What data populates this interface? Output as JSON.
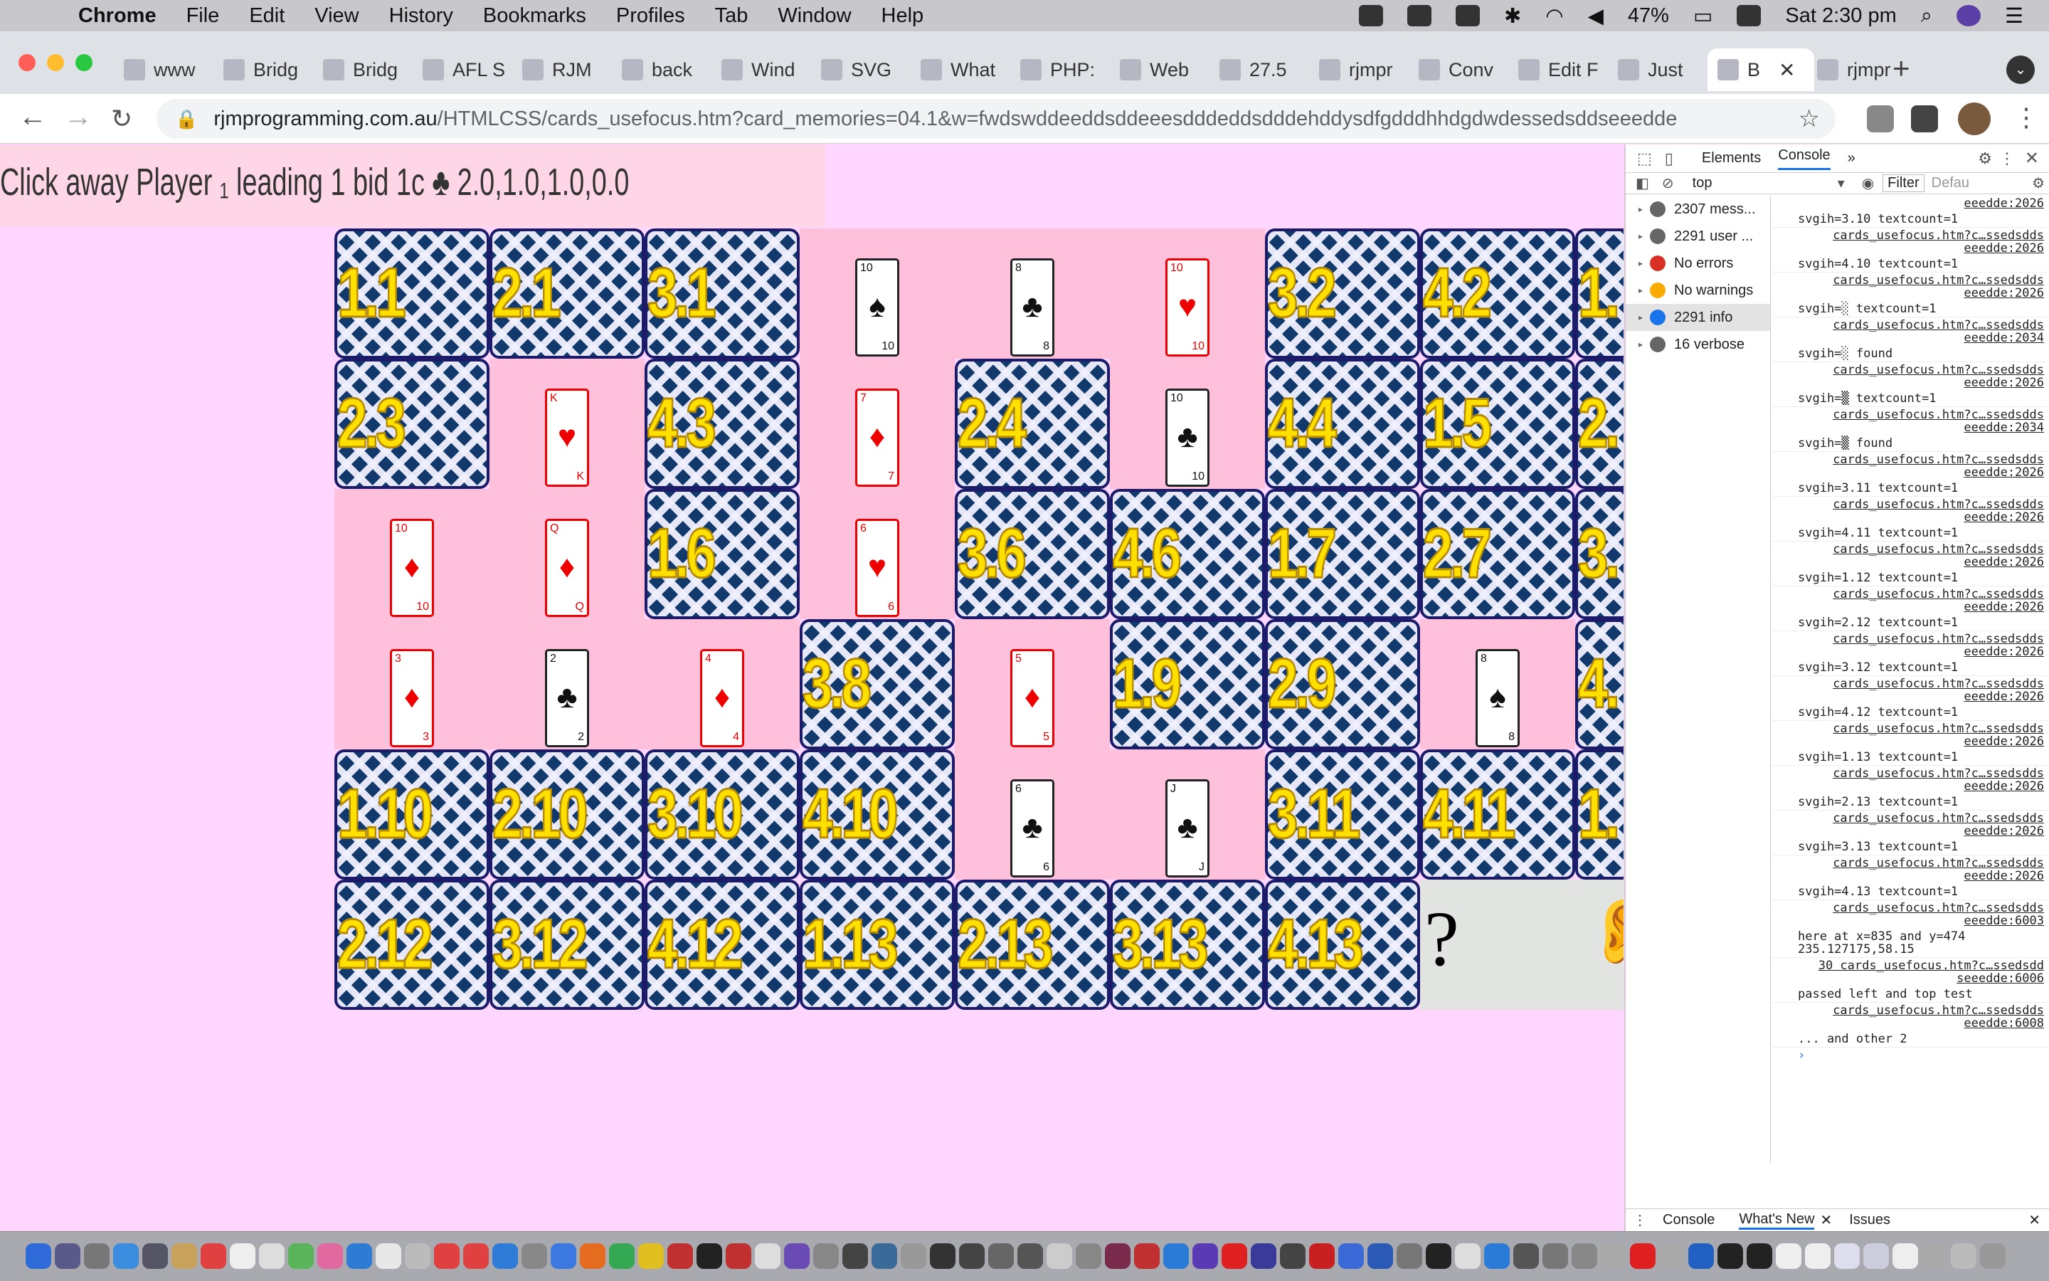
{
  "menubar": {
    "app": "Chrome",
    "items": [
      "File",
      "Edit",
      "View",
      "History",
      "Bookmarks",
      "Profiles",
      "Tab",
      "Window",
      "Help"
    ],
    "battery": "47%",
    "clock": "Sat 2:30 pm"
  },
  "tabs": [
    {
      "label": "www"
    },
    {
      "label": "Bridg"
    },
    {
      "label": "Bridg"
    },
    {
      "label": "AFL S"
    },
    {
      "label": "RJM"
    },
    {
      "label": "back"
    },
    {
      "label": "Wind"
    },
    {
      "label": "SVG"
    },
    {
      "label": "What"
    },
    {
      "label": "PHP:"
    },
    {
      "label": "Web"
    },
    {
      "label": "27.5"
    },
    {
      "label": "rjmpr"
    },
    {
      "label": "Conv"
    },
    {
      "label": "Edit F"
    },
    {
      "label": "Just"
    },
    {
      "label": "B",
      "active": true
    },
    {
      "label": "rjmpr"
    }
  ],
  "address": {
    "host": "rjmprogramming.com.au",
    "path": "/HTMLCSS/cards_usefocus.htm?card_memories=04.1&w=fwdswddeeddsddeeesdddeddsdddehddysdfgdddhhdgdwdessedsddseeedde"
  },
  "game": {
    "status": "Click away Player ₁ leading 1 bid 1c ♣ 2.0,1.0,1.0,0.0",
    "rows": [
      [
        {
          "t": "b",
          "l": "1.1"
        },
        {
          "t": "b",
          "l": "2.1"
        },
        {
          "t": "b",
          "l": "3.1"
        },
        {
          "t": "f",
          "r": "10",
          "s": "♠",
          "c": "black"
        },
        {
          "t": "f",
          "r": "8",
          "s": "♣",
          "c": "black"
        },
        {
          "t": "f",
          "r": "10",
          "s": "♥",
          "c": "red"
        },
        {
          "t": "b",
          "l": "3.2"
        },
        {
          "t": "b",
          "l": "4.2"
        },
        {
          "t": "b",
          "l": "1."
        }
      ],
      [
        {
          "t": "b",
          "l": "2.3"
        },
        {
          "t": "f",
          "r": "K",
          "s": "♥",
          "c": "red"
        },
        {
          "t": "b",
          "l": "4.3"
        },
        {
          "t": "f",
          "r": "7",
          "s": "♦",
          "c": "red"
        },
        {
          "t": "b",
          "l": "2.4"
        },
        {
          "t": "f",
          "r": "10",
          "s": "♣",
          "c": "black"
        },
        {
          "t": "b",
          "l": "4.4"
        },
        {
          "t": "b",
          "l": "1.5"
        },
        {
          "t": "b",
          "l": "2."
        }
      ],
      [
        {
          "t": "f",
          "r": "10",
          "s": "♦",
          "c": "red"
        },
        {
          "t": "f",
          "r": "Q",
          "s": "♦",
          "c": "red"
        },
        {
          "t": "b",
          "l": "1.6"
        },
        {
          "t": "f",
          "r": "6",
          "s": "♥",
          "c": "red"
        },
        {
          "t": "b",
          "l": "3.6"
        },
        {
          "t": "b",
          "l": "4.6"
        },
        {
          "t": "b",
          "l": "1.7"
        },
        {
          "t": "b",
          "l": "2.7"
        },
        {
          "t": "b",
          "l": "3."
        }
      ],
      [
        {
          "t": "f",
          "r": "3",
          "s": "♦",
          "c": "red"
        },
        {
          "t": "f",
          "r": "2",
          "s": "♣",
          "c": "black"
        },
        {
          "t": "f",
          "r": "4",
          "s": "♦",
          "c": "red"
        },
        {
          "t": "b",
          "l": "3.8"
        },
        {
          "t": "f",
          "r": "5",
          "s": "♦",
          "c": "red"
        },
        {
          "t": "b",
          "l": "1.9"
        },
        {
          "t": "b",
          "l": "2.9"
        },
        {
          "t": "f",
          "r": "8",
          "s": "♠",
          "c": "black"
        },
        {
          "t": "b",
          "l": "4."
        }
      ],
      [
        {
          "t": "b",
          "l": "1.10"
        },
        {
          "t": "b",
          "l": "2.10"
        },
        {
          "t": "b",
          "l": "3.10"
        },
        {
          "t": "b",
          "l": "4.10"
        },
        {
          "t": "f",
          "r": "6",
          "s": "♣",
          "c": "black"
        },
        {
          "t": "f",
          "r": "J",
          "s": "♣",
          "c": "black"
        },
        {
          "t": "b",
          "l": "3.11"
        },
        {
          "t": "b",
          "l": "4.11"
        },
        {
          "t": "b",
          "l": "1."
        }
      ],
      [
        {
          "t": "b",
          "l": "2.12"
        },
        {
          "t": "b",
          "l": "3.12"
        },
        {
          "t": "b",
          "l": "4.12"
        },
        {
          "t": "b",
          "l": "1.13"
        },
        {
          "t": "b",
          "l": "2.13"
        },
        {
          "t": "b",
          "l": "3.13"
        },
        {
          "t": "b",
          "l": "4.13"
        },
        {
          "t": "q",
          "l": "?"
        },
        {
          "t": "e",
          "l": "👂"
        }
      ]
    ]
  },
  "devtools": {
    "tabs": [
      "Elements",
      "Console",
      "»"
    ],
    "context": "top",
    "filter": "Filter",
    "levels": "Defau",
    "sidebar": [
      {
        "label": "2307 mess...",
        "icon": "list-icon"
      },
      {
        "label": "2291 user ...",
        "icon": "user-icon"
      },
      {
        "label": "No errors",
        "icon": "error-icon"
      },
      {
        "label": "No warnings",
        "icon": "warning-icon"
      },
      {
        "label": "2291 info",
        "icon": "info-icon",
        "selected": true
      },
      {
        "label": "16 verbose",
        "icon": "verbose-icon"
      }
    ],
    "log": [
      {
        "src": "eeedde:2026",
        "msg": "svgih=3.10 textcount=1"
      },
      {
        "src": "cards_usefocus.htm?c…ssedsdds eeedde:2026",
        "msg": "svgih=4.10 textcount=1"
      },
      {
        "src": "cards_usefocus.htm?c…ssedsdds eeedde:2026",
        "msg": "svgih=░ textcount=1"
      },
      {
        "src": "cards_usefocus.htm?c…ssedsdds eeedde:2034",
        "msg": "svgih=░ found"
      },
      {
        "src": "cards_usefocus.htm?c…ssedsdds eeedde:2026",
        "msg": "svgih=▒ textcount=1"
      },
      {
        "src": "cards_usefocus.htm?c…ssedsdds eeedde:2034",
        "msg": "svgih=▒ found"
      },
      {
        "src": "cards_usefocus.htm?c…ssedsdds eeedde:2026",
        "msg": "svgih=3.11 textcount=1"
      },
      {
        "src": "cards_usefocus.htm?c…ssedsdds eeedde:2026",
        "msg": "svgih=4.11 textcount=1"
      },
      {
        "src": "cards_usefocus.htm?c…ssedsdds eeedde:2026",
        "msg": "svgih=1.12 textcount=1"
      },
      {
        "src": "cards_usefocus.htm?c…ssedsdds eeedde:2026",
        "msg": "svgih=2.12 textcount=1"
      },
      {
        "src": "cards_usefocus.htm?c…ssedsdds eeedde:2026",
        "msg": "svgih=3.12 textcount=1"
      },
      {
        "src": "cards_usefocus.htm?c…ssedsdds eeedde:2026",
        "msg": "svgih=4.12 textcount=1"
      },
      {
        "src": "cards_usefocus.htm?c…ssedsdds eeedde:2026",
        "msg": "svgih=1.13 textcount=1"
      },
      {
        "src": "cards_usefocus.htm?c…ssedsdds eeedde:2026",
        "msg": "svgih=2.13 textcount=1"
      },
      {
        "src": "cards_usefocus.htm?c…ssedsdds eeedde:2026",
        "msg": "svgih=3.13 textcount=1"
      },
      {
        "src": "cards_usefocus.htm?c…ssedsdds eeedde:2026",
        "msg": "svgih=4.13 textcount=1"
      },
      {
        "src": "cards_usefocus.htm?c…ssedsdds eeedde:6003",
        "msg": "here at x=835 and y=474 235.127175,58.15"
      },
      {
        "src": "30  cards_usefocus.htm?c…ssedsdd seeedde:6006",
        "msg": "passed left and top test"
      },
      {
        "src": "cards_usefocus.htm?c…ssedsdds eeedde:6008",
        "msg": "... and other 2"
      }
    ],
    "drawer_tabs": [
      "Console",
      "What's New",
      "Issues"
    ]
  }
}
